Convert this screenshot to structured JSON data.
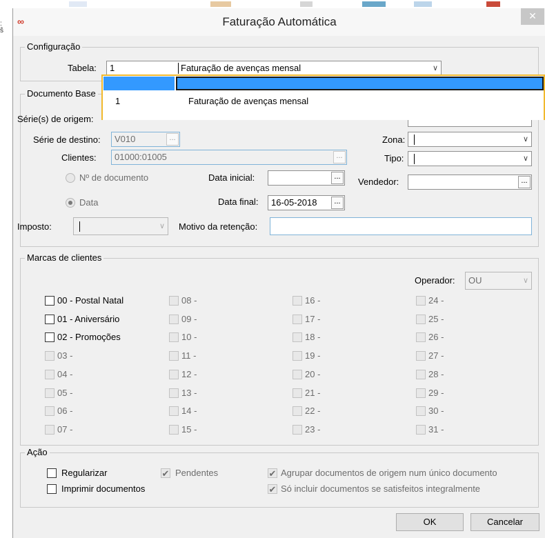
{
  "window": {
    "title": "Faturação Automática",
    "close_glyph": "✕",
    "app_icon": "∞"
  },
  "configuracao": {
    "legend": "Configuração",
    "tabela_label": "Tabela:",
    "tabela_code": "1",
    "tabela_name": "Faturação de avenças mensal"
  },
  "dropdown": {
    "rows": [
      {
        "code": "1",
        "name": "Faturação de avenças mensal"
      }
    ]
  },
  "documento_base": {
    "legend": "Documento Base",
    "series_origem_label": "Série(s) de origem:",
    "serie_destino_label": "Série de destino:",
    "serie_destino_value": "V010",
    "clientes_label": "Clientes:",
    "clientes_value": "01000:01005",
    "ndoc_label": "Nº de documento",
    "data_label": "Data",
    "data_inicial_label": "Data inicial:",
    "data_inicial_value": "",
    "data_final_label": "Data final:",
    "data_final_value": "16-05-2018",
    "zona_label": "Zona:",
    "tipo_label": "Tipo:",
    "vendedor_label": "Vendedor:",
    "imposto_label": "Imposto:",
    "motivo_label": "Motivo da retenção:",
    "dots": "..."
  },
  "marcas": {
    "legend": "Marcas de clientes",
    "operador_label": "Operador:",
    "operador_value": "OU",
    "col1": [
      "00 - Postal Natal",
      "01 - Aniversário",
      "02 - Promoções",
      "03 -",
      "04 -",
      "05 -",
      "06 -",
      "07 -"
    ],
    "col2": [
      "08 -",
      "09 -",
      "10 -",
      "11 -",
      "12 -",
      "13 -",
      "14 -",
      "15 -"
    ],
    "col3": [
      "16 -",
      "17 -",
      "18 -",
      "19 -",
      "20 -",
      "21 -",
      "22 -",
      "23 -"
    ],
    "col4": [
      "24 -",
      "25 -",
      "26 -",
      "27 -",
      "28 -",
      "29 -",
      "30 -",
      "31 -"
    ]
  },
  "acao": {
    "legend": "Ação",
    "regularizar": "Regularizar",
    "imprimir": "Imprimir documentos",
    "pendentes": "Pendentes",
    "agrupar": "Agrupar documentos de origem num único documento",
    "so_incluir": "Só incluir documentos se satisfeitos integralmente",
    "check_glyph": "✔"
  },
  "buttons": {
    "ok": "OK",
    "cancelar": "Cancelar"
  },
  "glyphs": {
    "chevron": "⌄",
    "chevron_down": "∨"
  },
  "colors": {
    "highlight": "#3399ff",
    "dropdown_border": "#f1b92d",
    "icon": "#d03b2b"
  }
}
